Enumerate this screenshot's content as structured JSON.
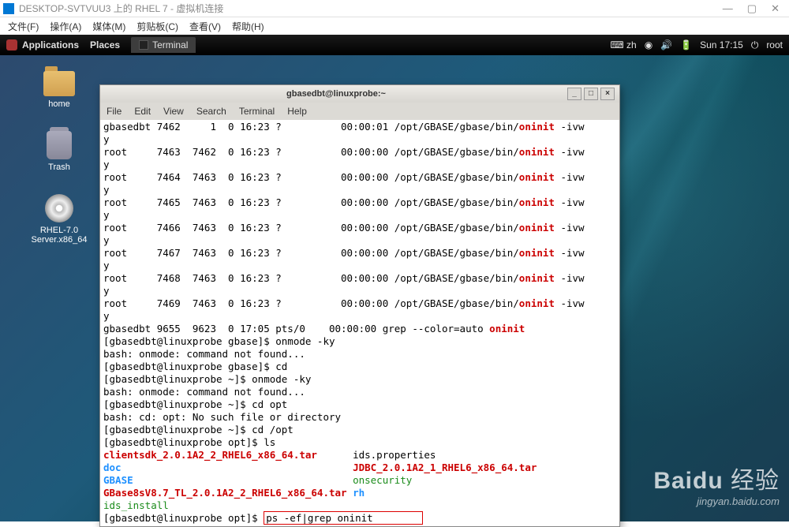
{
  "host_window": {
    "title": "DESKTOP-SVTVUU3 上的 RHEL 7 - 虚拟机连接",
    "menu": [
      "文件(F)",
      "操作(A)",
      "媒体(M)",
      "剪贴板(C)",
      "查看(V)",
      "帮助(H)"
    ]
  },
  "gnome": {
    "applications": "Applications",
    "places": "Places",
    "task_terminal": "Terminal",
    "time": "Sun 17:15",
    "user": "root"
  },
  "desktop_icons": {
    "home": "home",
    "trash": "Trash",
    "rhel": "RHEL-7.0 Server.x86_64"
  },
  "terminal": {
    "title": "gbasedbt@linuxprobe:~",
    "menu": [
      "File",
      "Edit",
      "View",
      "Search",
      "Terminal",
      "Help"
    ],
    "ps": [
      {
        "user": "gbasedbt",
        "pid": "7462",
        "ppid": "1",
        "c": "0",
        "stime": "16:23",
        "tty": "?",
        "time": "00:00:01",
        "cmd": "/opt/GBASE/gbase/bin/",
        "hi": "oninit",
        "args": " -ivw"
      },
      {
        "user": "root",
        "pid": "7463",
        "ppid": "7462",
        "c": "0",
        "stime": "16:23",
        "tty": "?",
        "time": "00:00:00",
        "cmd": "/opt/GBASE/gbase/bin/",
        "hi": "oninit",
        "args": " -ivw"
      },
      {
        "user": "root",
        "pid": "7464",
        "ppid": "7463",
        "c": "0",
        "stime": "16:23",
        "tty": "?",
        "time": "00:00:00",
        "cmd": "/opt/GBASE/gbase/bin/",
        "hi": "oninit",
        "args": " -ivw"
      },
      {
        "user": "root",
        "pid": "7465",
        "ppid": "7463",
        "c": "0",
        "stime": "16:23",
        "tty": "?",
        "time": "00:00:00",
        "cmd": "/opt/GBASE/gbase/bin/",
        "hi": "oninit",
        "args": " -ivw"
      },
      {
        "user": "root",
        "pid": "7466",
        "ppid": "7463",
        "c": "0",
        "stime": "16:23",
        "tty": "?",
        "time": "00:00:00",
        "cmd": "/opt/GBASE/gbase/bin/",
        "hi": "oninit",
        "args": " -ivw"
      },
      {
        "user": "root",
        "pid": "7467",
        "ppid": "7463",
        "c": "0",
        "stime": "16:23",
        "tty": "?",
        "time": "00:00:00",
        "cmd": "/opt/GBASE/gbase/bin/",
        "hi": "oninit",
        "args": " -ivw"
      },
      {
        "user": "root",
        "pid": "7468",
        "ppid": "7463",
        "c": "0",
        "stime": "16:23",
        "tty": "?",
        "time": "00:00:00",
        "cmd": "/opt/GBASE/gbase/bin/",
        "hi": "oninit",
        "args": " -ivw"
      },
      {
        "user": "root",
        "pid": "7469",
        "ppid": "7463",
        "c": "0",
        "stime": "16:23",
        "tty": "?",
        "time": "00:00:00",
        "cmd": "/opt/GBASE/gbase/bin/",
        "hi": "oninit",
        "args": " -ivw"
      }
    ],
    "greprow": {
      "user": "gbasedbt",
      "pid": "9655",
      "ppid": "9623",
      "c": "0",
      "stime": "17:05",
      "tty": "pts/0",
      "time": "00:00:00",
      "cmd": "grep --color=auto ",
      "hi": "oninit"
    },
    "lines": [
      "[gbasedbt@linuxprobe gbase]$ onmode -ky",
      "bash: onmode: command not found...",
      "[gbasedbt@linuxprobe gbase]$ cd",
      "[gbasedbt@linuxprobe ~]$ onmode -ky",
      "bash: onmode: command not found...",
      "[gbasedbt@linuxprobe ~]$ cd opt",
      "bash: cd: opt: No such file or directory",
      "[gbasedbt@linuxprobe ~]$ cd /opt",
      "[gbasedbt@linuxprobe opt]$ ls"
    ],
    "ls": {
      "l0a": "clientsdk_2.0.1A2_2_RHEL6_x86_64.tar",
      "l0b": "ids.properties",
      "l1a": "doc",
      "l1b": "JDBC_2.0.1A2_1_RHEL6_x86_64.tar",
      "l2a": "GBASE",
      "l2b": "onsecurity",
      "l3a": "GBase8sV8.7_TL_2.0.1A2_2_RHEL6_x86_64.tar",
      "l3b": "rh",
      "l4a": "ids_install"
    },
    "prompt": "[gbasedbt@linuxprobe opt]$ ",
    "boxed_cmd": "ps -ef|grep oninit"
  },
  "watermark": {
    "brand": "Baidu",
    "zh": "经验",
    "url": "jingyan.baidu.com"
  }
}
